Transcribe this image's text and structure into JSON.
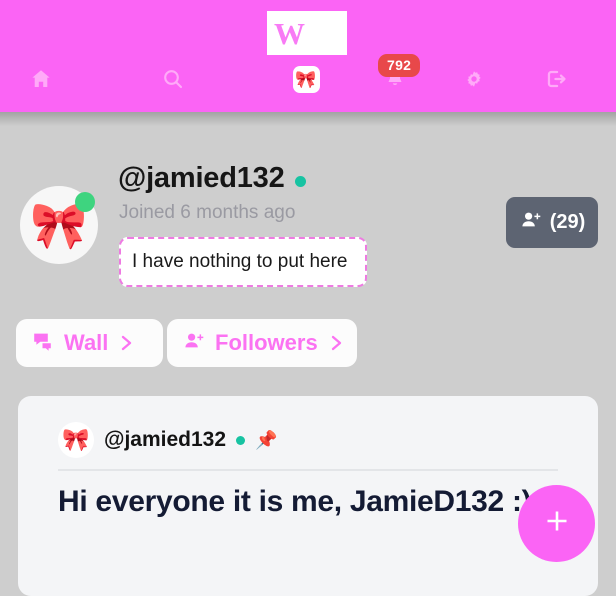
{
  "theme": {
    "brand_pink": "#fb64f5",
    "nav_icon_pink": "#ffaaf8",
    "badge_red": "#e8484a",
    "page_background": "#cecece",
    "card_background": "#f4f5f7",
    "follow_button_gray": "#5d6472",
    "online_green": "#17c3a2",
    "post_text_navy": "#141b34"
  },
  "header": {
    "logo_letter": "W",
    "nav": [
      {
        "name": "home",
        "icon": "home-icon",
        "label": "Home"
      },
      {
        "name": "search",
        "icon": "search-icon",
        "label": "Search"
      },
      {
        "name": "profile",
        "icon": "profile-avatar-icon",
        "label": "Profile",
        "avatar_emoji": "🎀"
      },
      {
        "name": "notifications",
        "icon": "bell-icon",
        "label": "Notifications",
        "badge": "792"
      },
      {
        "name": "settings",
        "icon": "gear-icon",
        "label": "Settings"
      },
      {
        "name": "logout",
        "icon": "logout-icon",
        "label": "Log out"
      }
    ],
    "notification_count": "792"
  },
  "profile": {
    "avatar_emoji": "🎀",
    "username": "@jamied132",
    "online": true,
    "joined": "Joined 6 months ago",
    "bio": "I have nothing to put here",
    "bio_placeholder": "I have nothing to put here",
    "follow_count": "(29)",
    "follow_icon": "person-add-icon"
  },
  "tabs": [
    {
      "label": "Wall",
      "icon": "chat-bubbles-icon",
      "chevron": "chevron-right-icon"
    },
    {
      "label": "Followers",
      "icon": "person-add-icon",
      "chevron": "chevron-right-icon"
    }
  ],
  "post": {
    "avatar_emoji": "🎀",
    "username": "@jamied132",
    "online": true,
    "pinned_icon": "📌",
    "body": "Hi everyone it is me, JamieD132 :)"
  },
  "fab": {
    "label": "+",
    "icon": "plus-icon"
  }
}
